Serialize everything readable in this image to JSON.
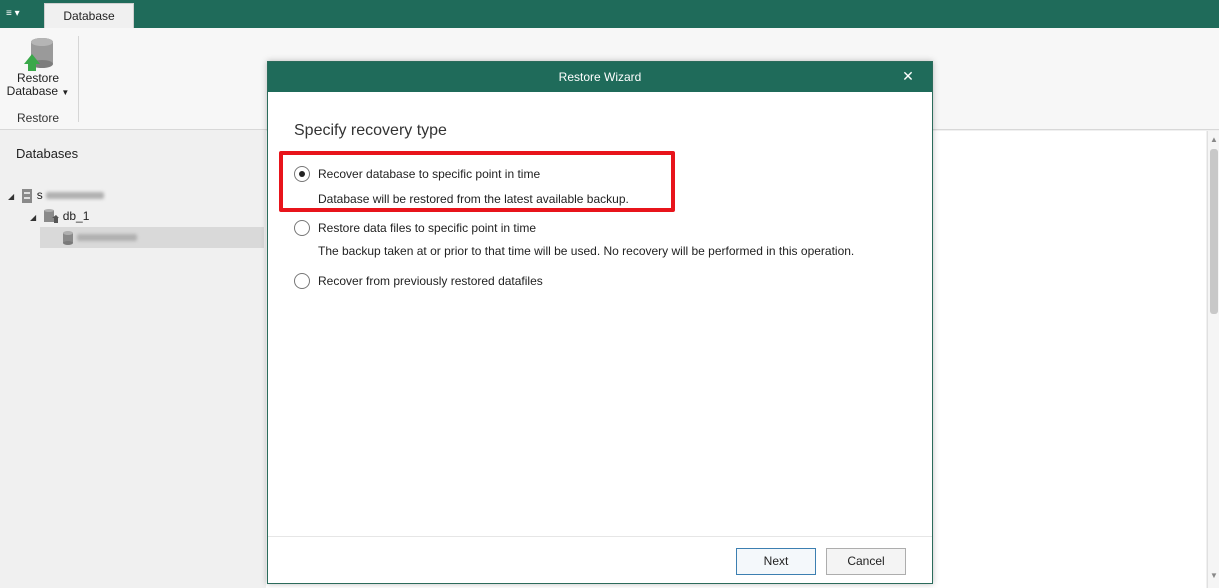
{
  "topbar": {
    "menu_icon": "menu-icon",
    "tab_label": "Database"
  },
  "ribbon": {
    "restore_button": {
      "line1": "Restore",
      "line2": "Database",
      "icon": "database-restore-icon"
    },
    "group_label": "Restore"
  },
  "left_panel": {
    "title": "Databases",
    "tree": [
      {
        "label": "s",
        "level": 0,
        "icon": "server-icon"
      },
      {
        "label": "db_1",
        "level": 1,
        "icon": "database-home-icon"
      },
      {
        "label": "",
        "level": 2,
        "icon": "database-icon",
        "selected": true
      }
    ]
  },
  "dialog": {
    "title": "Restore Wizard",
    "heading": "Specify recovery type",
    "options": [
      {
        "label": "Recover database to specific point in time",
        "description": "Database will be restored from the latest available backup.",
        "checked": true
      },
      {
        "label": "Restore data files to specific point in time",
        "description": "The backup taken at or prior to that time will be used. No recovery will be performed in this operation.",
        "checked": false
      },
      {
        "label": "Recover from previously restored datafiles",
        "description": "",
        "checked": false
      }
    ],
    "next_label": "Next",
    "cancel_label": "Cancel"
  },
  "colors": {
    "accent": "#1f6b5a",
    "highlight": "#e8141b",
    "primary_border": "#3c7fb1"
  }
}
